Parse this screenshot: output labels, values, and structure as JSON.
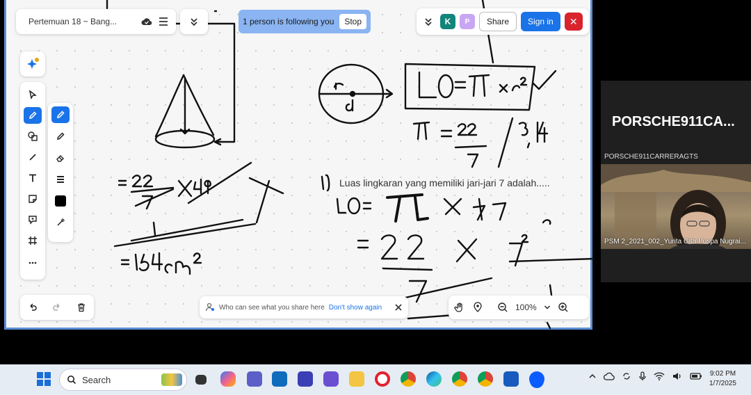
{
  "whiteboard": {
    "title": "Pertemuan 18 ~ Bang...",
    "follow_banner": "1 person is following you",
    "stop_label": "Stop",
    "avatars": [
      {
        "initial": "K",
        "color": "#12857a"
      },
      {
        "initial": "P",
        "color": "#c9a6f2"
      }
    ],
    "share_label": "Share",
    "signin_label": "Sign in",
    "close_label": "✕",
    "privacy_text": "Who can see what you share here",
    "privacy_link": "Don't show again",
    "zoom_level": "100%",
    "accent_color": "#1a73e8"
  },
  "board_text": {
    "question": "Luas lingkaran yang memiliki jari-jari 7 adalah....."
  },
  "participant": {
    "big_name": "PORSCHE911CA...",
    "small_name": "PORSCHE911CARRERAGTS",
    "video_label": "PSM 2_2021_002_Yurita Gita Puspa Nugrai..."
  },
  "taskbar": {
    "search_placeholder": "Search",
    "time": "9:02 PM",
    "date": "1/7/2025"
  }
}
